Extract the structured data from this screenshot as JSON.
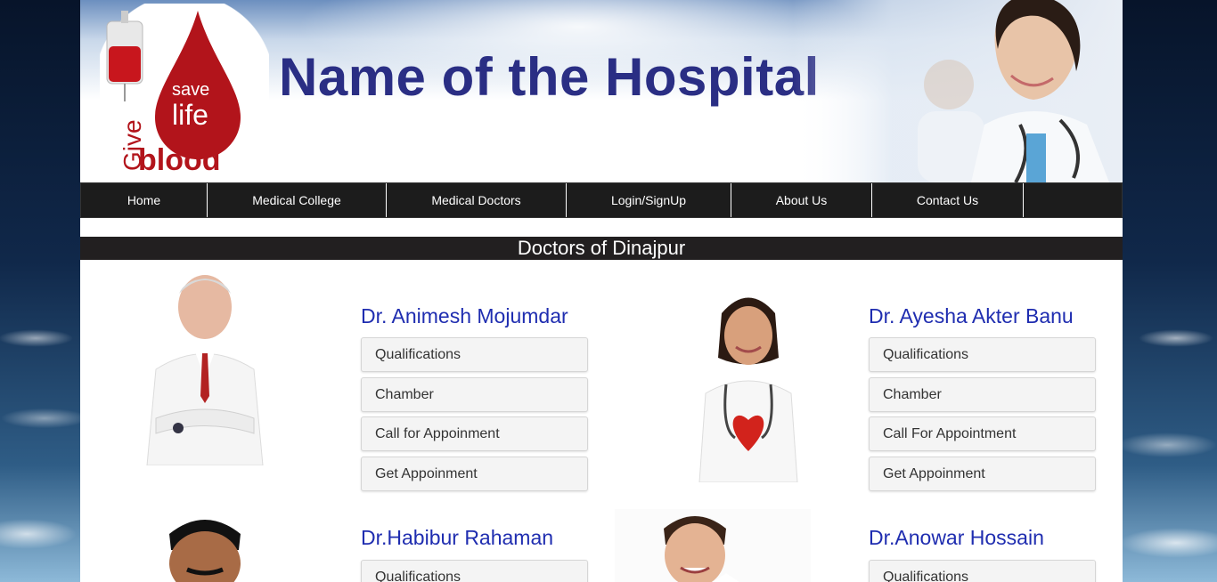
{
  "header": {
    "title": "Name of the Hospital",
    "logo": {
      "icon": "blood-drop-logo",
      "line1": "save",
      "line2": "life",
      "give": "Give",
      "blood": "blood"
    }
  },
  "nav": {
    "items": [
      {
        "label": "Home"
      },
      {
        "label": "Medical College"
      },
      {
        "label": "Medical Doctors"
      },
      {
        "label": "Login/SignUp"
      },
      {
        "label": "About Us"
      },
      {
        "label": "Contact Us"
      }
    ]
  },
  "section": {
    "title": "Doctors of Dinajpur"
  },
  "doctors": [
    {
      "name": "Dr. Animesh Mojumdar",
      "buttons": [
        "Qualifications",
        "Chamber",
        "Call for Appoinment",
        "Get Appoinment"
      ]
    },
    {
      "name": "Dr. Ayesha Akter Banu",
      "buttons": [
        "Qualifications",
        "Chamber",
        "Call For Appointment",
        "Get Appoinment"
      ]
    },
    {
      "name": "Dr.Habibur Rahaman",
      "buttons": [
        "Qualifications"
      ]
    },
    {
      "name": "Dr.Anowar Hossain",
      "buttons": [
        "Qualifications"
      ]
    }
  ],
  "colors": {
    "title": "#2a2e84",
    "doctor_name": "#1f2db0",
    "nav_bg": "#1c1c1c",
    "logo_red": "#b2141b"
  }
}
